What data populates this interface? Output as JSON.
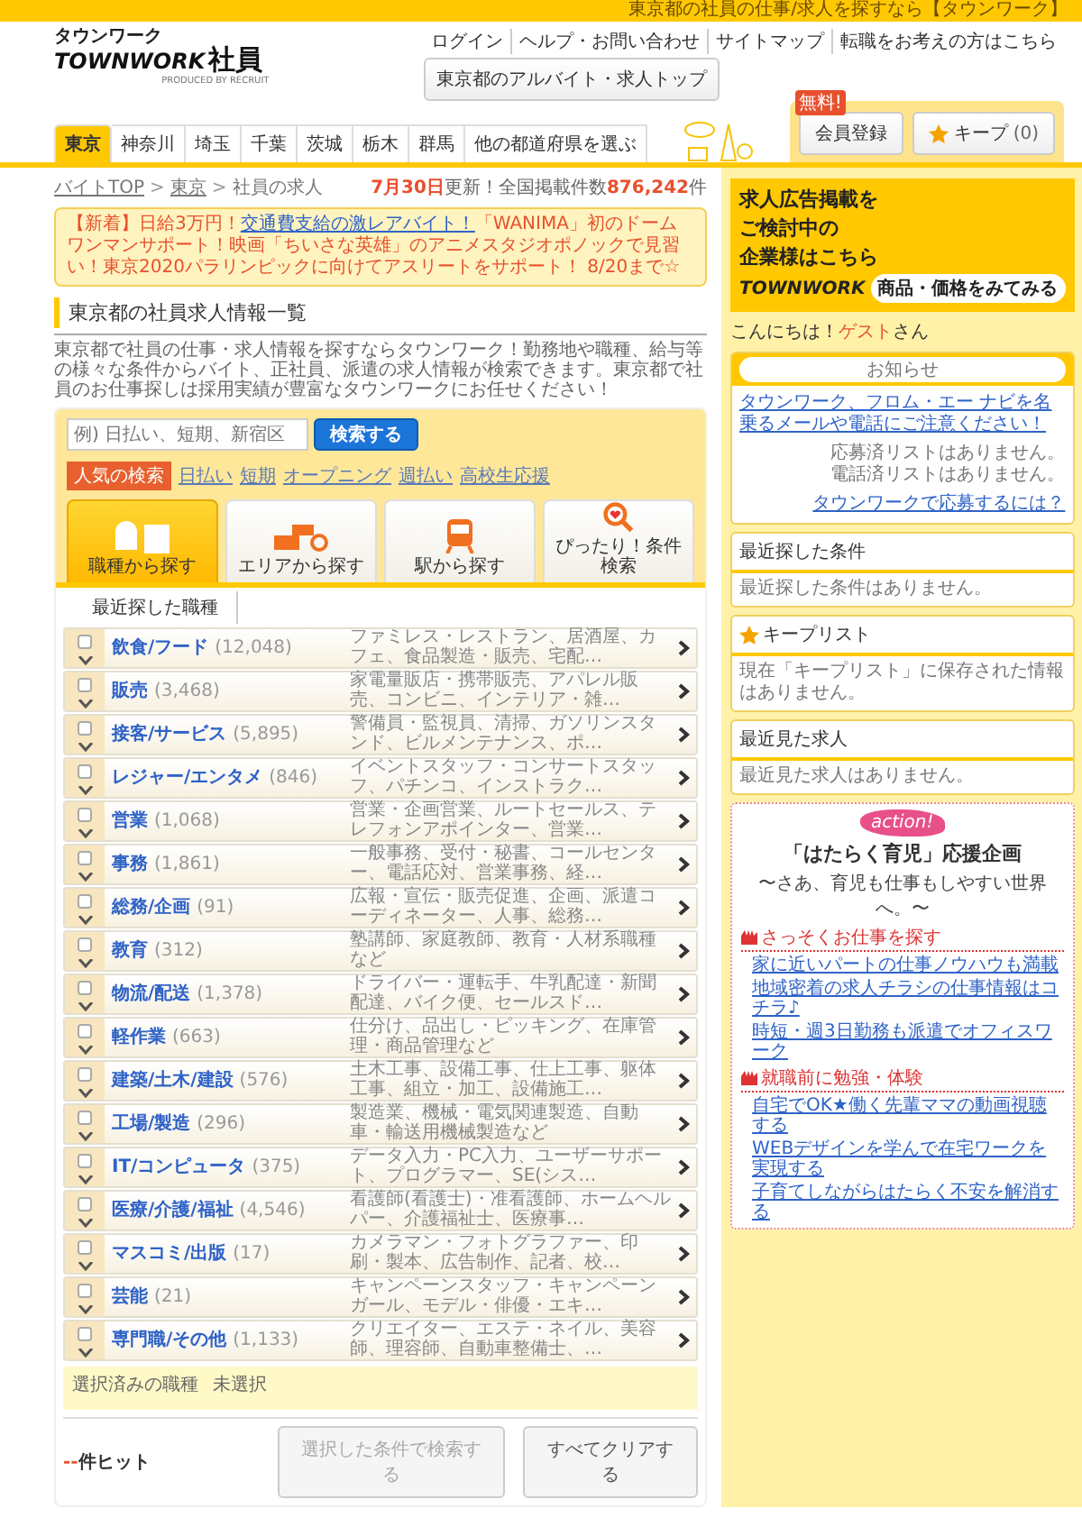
{
  "top_bar": {
    "text": "東京都の社員の仕事/求人を探すなら【タウンワーク】"
  },
  "header": {
    "logo": {
      "kana": "タウンワーク",
      "brand": "TOWNWORK",
      "word": "社員",
      "credit": "PRODUCED BY RECRUIT"
    },
    "top_button": "東京都のアルバイト・求人トップ",
    "links": [
      "ログイン",
      "ヘルプ・お問い合わせ",
      "サイトマップ",
      "転職をお考えの方はこちら"
    ],
    "region_tabs": [
      {
        "label": "東京",
        "selected": true
      },
      {
        "label": "神奈川",
        "selected": false
      },
      {
        "label": "埼玉",
        "selected": false
      },
      {
        "label": "千葉",
        "selected": false
      },
      {
        "label": "茨城",
        "selected": false
      },
      {
        "label": "栃木",
        "selected": false
      },
      {
        "label": "群馬",
        "selected": false
      },
      {
        "label": "他の都道府県を選ぶ",
        "selected": false
      }
    ],
    "member_button": {
      "badge": "無料!",
      "label": "会員登録"
    },
    "keep_button": {
      "label": "キープ",
      "count": "(0)"
    }
  },
  "breadcrumb": {
    "items": [
      "バイトTOP",
      "東京",
      "社員の求人"
    ],
    "separator": ">"
  },
  "update": {
    "date": "7月30日",
    "text": "更新！全国掲載件数",
    "count": "876,242",
    "unit": "件"
  },
  "notice": {
    "lead": "【新着】日給3万円！",
    "link": "交通費支給の激レアバイト！",
    "rest": "「WANIMA」初のドームワンマンサポート！映画「ちいさな英雄」のアニメスタジオポノックで見習い！東京2020パラリンピックに向けてアスリートをサポート！ 8/20まで☆"
  },
  "section_title": "東京都の社員求人情報一覧",
  "intro": "東京都で社員の仕事・求人情報を探すならタウンワーク！勤務地や職種、給与等の様々な条件からバイト、正社員、派遣の求人情報が検索できます。東京都で社員のお仕事探しは採用実績が豊富なタウンワークにお任せください！",
  "search": {
    "placeholder": "例) 日払い、短期、新宿区",
    "button": "検索する",
    "popular_label": "人気の検索",
    "popular": [
      "日払い",
      "短期",
      "オープニング",
      "週払い",
      "高校生応援"
    ]
  },
  "search_tabs": [
    {
      "label": "職種から探す",
      "kind": "job",
      "selected": true
    },
    {
      "label": "エリアから探す",
      "kind": "area",
      "selected": false
    },
    {
      "label": "駅から探す",
      "kind": "station",
      "selected": false
    },
    {
      "label": "ぴったり！条件検索",
      "kind": "match",
      "selected": false
    }
  ],
  "recent_tab": "最近探した職種",
  "categories": [
    {
      "name": "飲食/フード",
      "count": "(12,048)",
      "description": "ファミレス・レストラン、居酒屋、カフェ、食品製造・販売、宅配…",
      "checked": false
    },
    {
      "name": "販売",
      "count": "(3,468)",
      "description": "家電量販店・携帯販売、アパレル販売、コンビニ、インテリア・雑…",
      "checked": false
    },
    {
      "name": "接客/サービス",
      "count": "(5,895)",
      "description": "警備員・監視員、清掃、ガソリンスタンド、ビルメンテナンス、ポ…",
      "checked": false
    },
    {
      "name": "レジャー/エンタメ",
      "count": "(846)",
      "description": "イベントスタッフ・コンサートスタッフ、パチンコ、インストラク…",
      "checked": false
    },
    {
      "name": "営業",
      "count": "(1,068)",
      "description": "営業・企画営業、ルートセールス、テレフォンアポインター、営業…",
      "checked": false
    },
    {
      "name": "事務",
      "count": "(1,861)",
      "description": "一般事務、受付・秘書、コールセンター、電話応対、営業事務、経…",
      "checked": false
    },
    {
      "name": "総務/企画",
      "count": "(91)",
      "description": "広報・宣伝・販売促進、企画、派遣コーディネーター、人事、総務…",
      "checked": false
    },
    {
      "name": "教育",
      "count": "(312)",
      "description": "塾講師、家庭教師、教育・人材系職種など",
      "checked": false
    },
    {
      "name": "物流/配送",
      "count": "(1,378)",
      "description": "ドライバー・運転手、牛乳配達・新聞配達、バイク便、セールスド…",
      "checked": false
    },
    {
      "name": "軽作業",
      "count": "(663)",
      "description": "仕分け、品出し・ピッキング、在庫管理・商品管理など",
      "checked": false
    },
    {
      "name": "建築/土木/建設",
      "count": "(576)",
      "description": "土木工事、設備工事、仕上工事、躯体工事、組立・加工、設備施工…",
      "checked": false
    },
    {
      "name": "工場/製造",
      "count": "(296)",
      "description": "製造業、機械・電気関連製造、自動車・輸送用機械製造など",
      "checked": false
    },
    {
      "name": "IT/コンピュータ",
      "count": "(375)",
      "description": "データ入力・PC入力、ユーザーサポート、プログラマー、SE(シス…",
      "checked": false
    },
    {
      "name": "医療/介護/福祉",
      "count": "(4,546)",
      "description": "看護師(看護士)・准看護師、ホームヘルパー、介護福祉士、医療事…",
      "checked": false
    },
    {
      "name": "マスコミ/出版",
      "count": "(17)",
      "description": "カメラマン・フォトグラファー、印刷・製本、広告制作、記者、校…",
      "checked": false
    },
    {
      "name": "芸能",
      "count": "(21)",
      "description": "キャンペーンスタッフ・キャンペーンガール、モデル・俳優・エキ…",
      "checked": false
    },
    {
      "name": "専門職/その他",
      "count": "(1,133)",
      "description": "クリエイター、エステ・ネイル、美容師、理容師、自動車整備士、…",
      "checked": false
    }
  ],
  "selected_box": {
    "label": "選択済みの職種",
    "value": "未選択"
  },
  "footer": {
    "hits_count": "--",
    "hits_label": "件ヒット",
    "search_button": {
      "label": "選択した条件で検索する",
      "disabled": true
    },
    "clear_button": "すべてクリアする"
  },
  "sidebar": {
    "ad": {
      "lines": [
        "求人広告掲載を",
        "ご検討中の",
        "企業様はこちら"
      ],
      "brand": "TOWNWORK",
      "button": "商品・価格をみてみる"
    },
    "greeting": {
      "hello": "こんにちは！",
      "name": "ゲスト",
      "suffix": "さん"
    },
    "news": {
      "title": "お知らせ",
      "warning": "タウンワーク、フロム・エー ナビを名乗るメールや電話にご注意ください！",
      "lines": [
        "応募済リストはありません。",
        "電話済リストはありません。"
      ],
      "help_link": "タウンワークで応募するには？"
    },
    "panels": [
      {
        "title": "最近探した条件",
        "starred": false,
        "body": "最近探した条件はありません。"
      },
      {
        "title": "キープリスト",
        "starred": true,
        "body": "現在「キープリスト」に保存された情報はありません。"
      },
      {
        "title": "最近見た求人",
        "starred": false,
        "body": "最近見た求人はありません。"
      }
    ],
    "campaign": {
      "badge": "action!",
      "title": "「はたらく育児」応援企画",
      "subtitle": "〜さあ、育児も仕事もしやすい世界へ。〜",
      "sections": [
        {
          "heading": "さっそくお仕事を探す",
          "links": [
            "家に近いパートの仕事ノウハウも満載",
            "地域密着の求人チラシの仕事情報はコチラ♪",
            "時短・週3日勤務も派遣でオフィスワーク"
          ]
        },
        {
          "heading": "就職前に勉強・体験",
          "links": [
            "自宅でOK★働く先輩ママの動画視聴する",
            "WEBデザインを学んで在宅ワークを実現する",
            "子育てしながらはたらく不安を解消する"
          ]
        }
      ]
    }
  }
}
